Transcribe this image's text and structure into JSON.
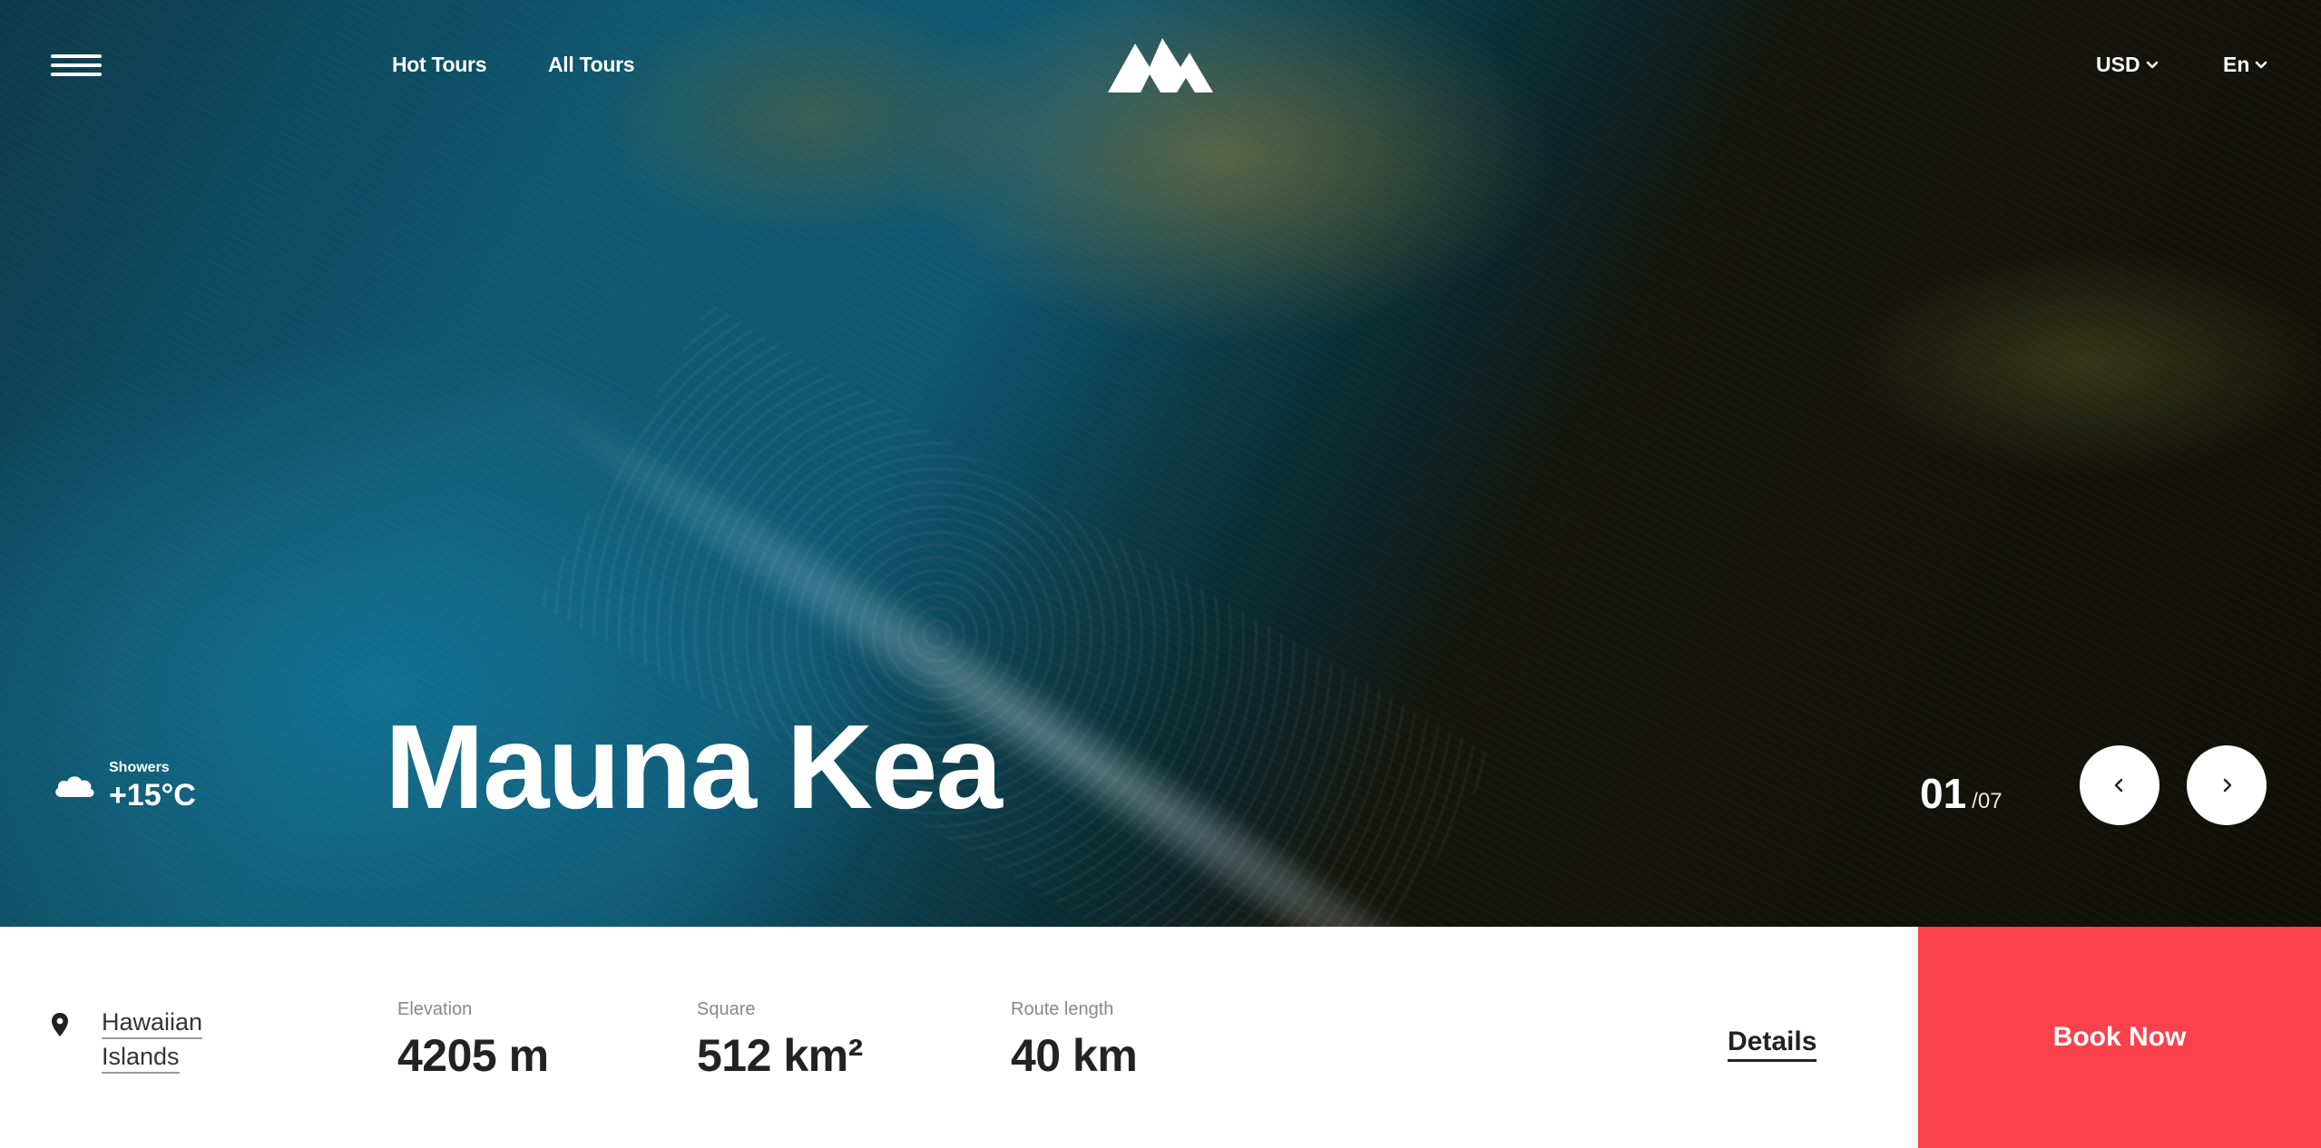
{
  "nav": {
    "menu_icon": "hamburger-icon",
    "links": [
      "Hot Tours",
      "All Tours"
    ],
    "logo_icon": "mountain-logo-icon",
    "currency": "USD",
    "language": "En"
  },
  "weather": {
    "icon": "cloud-icon",
    "label": "Showers",
    "temperature": "+15°C"
  },
  "hero": {
    "title": "Mauna Kea"
  },
  "slider": {
    "current": "01",
    "total": "/07",
    "prev_icon": "chevron-left-icon",
    "next_icon": "chevron-right-icon"
  },
  "info": {
    "location_icon": "map-pin-icon",
    "location_line1": "Hawaiian",
    "location_line2": "Islands",
    "stats": [
      {
        "label": "Elevation",
        "value": "4205 m"
      },
      {
        "label": "Square",
        "value": "512 km²"
      },
      {
        "label": "Route length",
        "value": "40 km"
      }
    ],
    "details_label": "Details",
    "book_label": "Book Now"
  },
  "colors": {
    "accent": "#fb424c",
    "bar_background": "#ffffff",
    "text_dark": "#222222"
  }
}
